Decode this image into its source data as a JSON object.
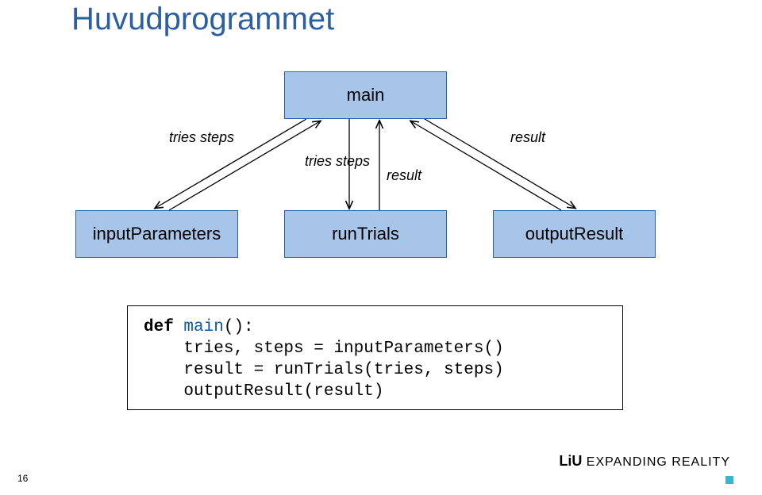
{
  "title": "Huvudprogrammet",
  "boxes": {
    "main": "main",
    "inputParameters": "inputParameters",
    "runTrials": "runTrials",
    "outputResult": "outputResult"
  },
  "labels": {
    "left": "tries\nsteps",
    "mid_left": "tries\nsteps",
    "mid_right": "result",
    "right": "result"
  },
  "code": {
    "kw_def": "def",
    "kw_main": "main",
    "paren": "():",
    "line2": "    tries, steps = inputParameters()",
    "line3": "    result = runTrials(tries, steps)",
    "line4": "    outputResult(result)"
  },
  "footer": {
    "liu": "LiU",
    "tagline": " EXPANDING REALITY",
    "page": "16"
  }
}
